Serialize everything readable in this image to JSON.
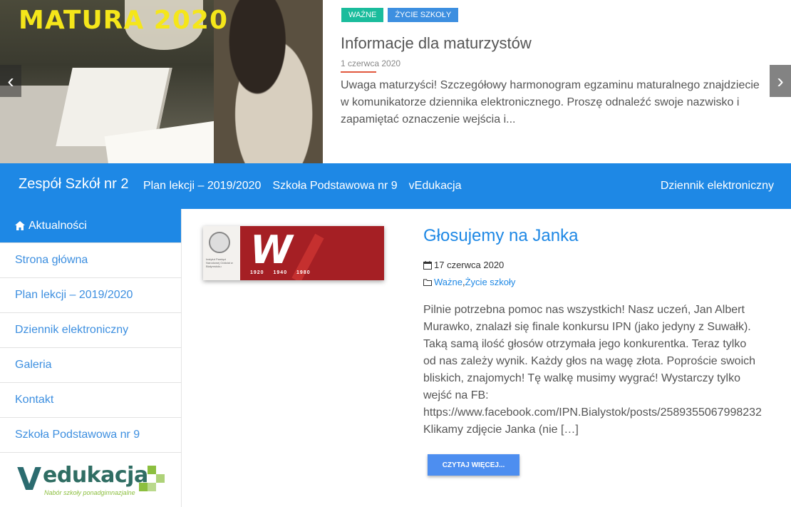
{
  "slider": {
    "caption": "MATURA 2020",
    "prev_arrow": "‹",
    "next_arrow": "›",
    "tags": [
      "Ważne",
      "Życie szkoły"
    ],
    "title": "Informacje dla maturzystów",
    "date": "1 czerwca 2020",
    "excerpt": "Uwaga maturzyści! Szczegółowy harmonogram egzaminu maturalnego znajdziecie w komunikatorze dziennika elektronicznego. Proszę odnaleźć swoje nazwisko i zapamiętać oznaczenie wejścia i...",
    "colors": {
      "tag_wazne": "#1abc9c",
      "tag_zycie": "#3d8fe0",
      "caption": "#f5e61a",
      "underline": "#e2583e"
    }
  },
  "navbar": {
    "brand": "Zespół Szkół nr 2",
    "links": [
      "Plan lekcji – 2019/2020",
      "Szkoła Podstawowa nr 9",
      "vEdukacja"
    ],
    "right_link": "Dziennik elektroniczny",
    "color": "#1e88e5"
  },
  "sidebar": {
    "items": [
      {
        "label": "Aktualności",
        "icon": "home-icon",
        "active": true
      },
      {
        "label": "Strona główna"
      },
      {
        "label": "Plan lekcji – 2019/2020"
      },
      {
        "label": "Dziennik elektroniczny"
      },
      {
        "label": "Galeria"
      },
      {
        "label": "Kontakt"
      },
      {
        "label": "Szkoła Podstawowa nr 9"
      }
    ],
    "logo": {
      "letter": "V",
      "word": "edukacja",
      "subtitle": "Nabór szkoły ponadgimnazjalne"
    }
  },
  "post": {
    "thumbnail": {
      "years": "1920 1940 1980",
      "ipn_text": "Instytut Pamięci Narodowej Oddział w Białymstoku"
    },
    "title": "Głosujemy na Janka",
    "date": "17 czerwca 2020",
    "categories": [
      "Ważne",
      "Życie szkoły"
    ],
    "category_separator": ", ",
    "text_lines": [
      "Pilnie potrzebna pomoc nas wszystkich! Nasz uczeń, Jan Albert",
      "Murawko, znalazł się finale konkursu IPN (jako jedyny z Suwałk).",
      "Taką samą ilość głosów otrzymała jego konkurentka. Teraz tylko",
      "od nas zależy wynik. Każdy głos na wagę złota. Poproście swoich",
      "bliskich, znajomych! Tę walkę musimy wygrać! Wystarczy tylko",
      "wejść na FB:",
      "https://www.facebook.com/IPN.Bialystok/posts/2589355067998232",
      "Klikamy zdjęcie Janka (nie […]"
    ],
    "read_more": "Czytaj więcej..."
  }
}
